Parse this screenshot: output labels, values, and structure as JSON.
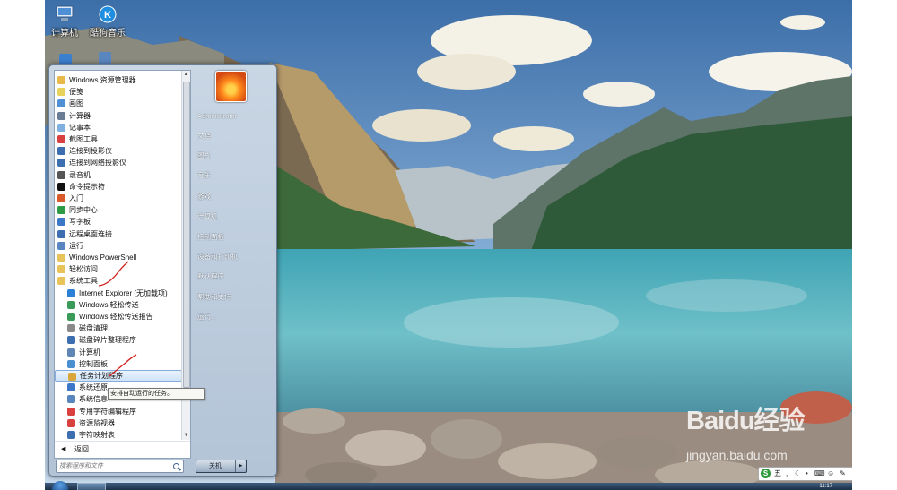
{
  "desktop": {
    "icons": [
      {
        "label": "计算机",
        "icon": "computer-icon"
      },
      {
        "label": "酷狗音乐",
        "icon": "kugou-icon"
      }
    ]
  },
  "start_menu": {
    "programs": [
      {
        "label": "Windows 资源管理器",
        "icon": "explorer-icon",
        "color": "#e8b84a"
      },
      {
        "label": "便笺",
        "icon": "sticky-notes-icon",
        "color": "#e9d25a"
      },
      {
        "label": "画图",
        "icon": "paint-icon",
        "color": "#4f8fd6"
      },
      {
        "label": "计算器",
        "icon": "calculator-icon",
        "color": "#6b7d94"
      },
      {
        "label": "记事本",
        "icon": "notepad-icon",
        "color": "#7fb0e0"
      },
      {
        "label": "截图工具",
        "icon": "snipping-tool-icon",
        "color": "#d94040"
      },
      {
        "label": "连接到投影仪",
        "icon": "projector-icon",
        "color": "#3d6fb0"
      },
      {
        "label": "连接到网络投影仪",
        "icon": "network-projector-icon",
        "color": "#3d6fb0"
      },
      {
        "label": "录音机",
        "icon": "microphone-icon",
        "color": "#555555"
      },
      {
        "label": "命令提示符",
        "icon": "cmd-icon",
        "color": "#111111"
      },
      {
        "label": "入门",
        "icon": "getting-started-icon",
        "color": "#d95a2a"
      },
      {
        "label": "同步中心",
        "icon": "sync-center-icon",
        "color": "#2e9a44"
      },
      {
        "label": "写字板",
        "icon": "wordpad-icon",
        "color": "#3d78c8"
      },
      {
        "label": "远程桌面连接",
        "icon": "remote-desktop-icon",
        "color": "#3d6fb0"
      },
      {
        "label": "运行",
        "icon": "run-icon",
        "color": "#5a86c0"
      },
      {
        "label": "Windows PowerShell",
        "icon": "folder-icon",
        "color": "#e8c35a"
      },
      {
        "label": "轻松访问",
        "icon": "folder-icon",
        "color": "#e8c35a"
      },
      {
        "label": "系统工具",
        "icon": "folder-icon",
        "color": "#e8c35a"
      },
      {
        "label": "Internet Explorer (无加载项)",
        "icon": "ie-icon",
        "color": "#2b7fd6"
      },
      {
        "label": "Windows 轻松传送",
        "icon": "easy-transfer-icon",
        "color": "#3a9a5a"
      },
      {
        "label": "Windows 轻松传送报告",
        "icon": "easy-transfer-report-icon",
        "color": "#3a9a5a"
      },
      {
        "label": "磁盘清理",
        "icon": "disk-cleanup-icon",
        "color": "#8a8a8a"
      },
      {
        "label": "磁盘碎片整理程序",
        "icon": "defrag-icon",
        "color": "#3d6fb0"
      },
      {
        "label": "计算机",
        "icon": "computer-icon",
        "color": "#5f86b5"
      },
      {
        "label": "控制面板",
        "icon": "control-panel-icon",
        "color": "#4a8fd0"
      },
      {
        "label": "任务计划程序",
        "icon": "task-scheduler-icon",
        "color": "#d9a63a"
      },
      {
        "label": "系统还原",
        "icon": "system-restore-icon",
        "color": "#3d78c8"
      },
      {
        "label": "系统信息",
        "icon": "system-info-icon",
        "color": "#5a86c0"
      },
      {
        "label": "专用字符编辑程序",
        "icon": "char-editor-icon",
        "color": "#d94040"
      },
      {
        "label": "资源监视器",
        "icon": "resource-monitor-icon",
        "color": "#d94040"
      },
      {
        "label": "字符映射表",
        "icon": "char-map-icon",
        "color": "#3d6fb0"
      }
    ],
    "selected_program": "任务计划程序",
    "back_label": "返回",
    "search_placeholder": "搜索程序和文件",
    "right_items": [
      "Administrator",
      "文档",
      "图片",
      "音乐",
      "游戏",
      "计算机",
      "控制面板",
      "设备和打印机",
      "默认程序",
      "帮助和支持",
      "运行..."
    ],
    "shutdown_label": "关机"
  },
  "tooltip": "安排自动运行的任务。",
  "ime_bar": {
    "logo": "S",
    "mode": "五"
  },
  "taskbar": {
    "clock": "11:17"
  },
  "watermark": {
    "brand": "Baidu经验",
    "sub": "jingyan.baidu.com"
  }
}
